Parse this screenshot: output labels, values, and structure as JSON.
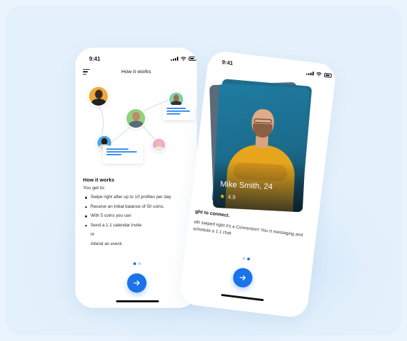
{
  "phone1": {
    "time": "9:41",
    "screen_title": "How it works",
    "section_title": "How it works",
    "intro": "You get to:",
    "list": [
      {
        "text": "Swipe right after up to 10 profiles per day",
        "bullet": true
      },
      {
        "text": "Receive an initial balance of 50 coins.",
        "bullet": true
      },
      {
        "text": "With 5 coins you can",
        "bullet": true
      },
      {
        "text": "Send a 1:1 calendar invite",
        "bullet": true
      },
      {
        "text": "or",
        "bullet": false
      },
      {
        "text": "Attend an event.",
        "bullet": false
      }
    ],
    "pagination": {
      "active_index": 0,
      "count": 2
    }
  },
  "phone2": {
    "time": "9:41",
    "profile": {
      "name": "Mike Smith, 24",
      "rating": "4.9"
    },
    "title": "ght to connect.",
    "body": "oth swiped right it's a Connection! You rt messaging and schedule a 1:1 chat",
    "pagination": {
      "active_index": 1,
      "count": 2
    }
  },
  "colors": {
    "accent": "#1a73e8",
    "background": "#eaf4fd",
    "card_teal": "#1b6b8b",
    "sweater": "#e6a51d",
    "star": "#f4c400"
  },
  "icons": [
    "menu-icon",
    "signal-icon",
    "wifi-icon",
    "battery-icon",
    "arrow-right-icon",
    "star-icon"
  ]
}
